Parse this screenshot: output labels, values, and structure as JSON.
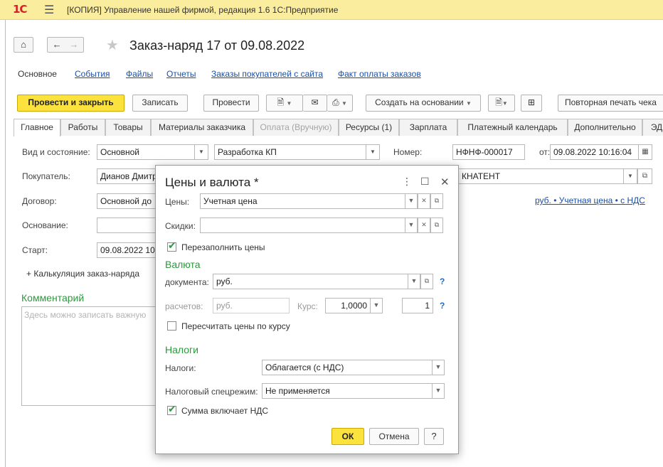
{
  "app": {
    "logo": "1С",
    "title": "[КОПИЯ] Управление нашей фирмой, редакция 1.6 1С:Предприятие"
  },
  "document": {
    "title": "Заказ-наряд 17 от 09.08.2022"
  },
  "subnav": [
    "Основное",
    "События",
    "Файлы",
    "Отчеты",
    "Заказы покупателей с сайта",
    "Факт оплаты заказов"
  ],
  "toolbar": {
    "post_close": "Провести и закрыть",
    "save": "Записать",
    "post": "Провести",
    "create_based": "Создать на основании",
    "reprint": "Повторная печать чека"
  },
  "tabs": [
    "Главное",
    "Работы",
    "Товары",
    "Материалы заказчика",
    "Оплата (Вручную)",
    "Ресурсы (1)",
    "Зарплата",
    "Платежный календарь",
    "Дополнительно",
    "ЭД"
  ],
  "form": {
    "kind_label": "Вид и состояние:",
    "kind_value": "Основной",
    "state_value": "Разработка КП",
    "number_label": "Номер:",
    "number_value": "НФНФ-000017",
    "from_label": "от:",
    "date_value": "09.08.2022 10:16:04",
    "buyer_label": "Покупатель:",
    "buyer_value": "Дианов Дмитр",
    "buyer_right": "КНАТЕНТ",
    "contract_label": "Договор:",
    "contract_value": "Основной до",
    "price_link": "руб. • Учетная цена • с НДС",
    "basis_label": "Основание:",
    "basis_value": "",
    "start_label": "Старт:",
    "start_value": "09.08.2022 10",
    "calc_link": "+ Калькуляция заказ-наряда",
    "comment_title": "Комментарий",
    "comment_placeholder": "Здесь можно записать важную"
  },
  "dialog": {
    "title": "Цены и валюта *",
    "prices_label": "Цены:",
    "prices_value": "Учетная цена",
    "discounts_label": "Скидки:",
    "discounts_value": "",
    "refill_label": "Перезаполнить цены",
    "currency_header": "Валюта",
    "doc_currency_label": "документа:",
    "doc_currency_value": "руб.",
    "settle_label": "расчетов:",
    "settle_value": "руб.",
    "rate_label": "Курс:",
    "rate_value": "1,0000",
    "multiplicity_value": "1",
    "recalc_label": "Пересчитать цены по курсу",
    "taxes_header": "Налоги",
    "taxes_label": "Налоги:",
    "taxes_value": "Облагается (с НДС)",
    "tax_regime_label": "Налоговый спецрежим:",
    "tax_regime_value": "Не применяется",
    "vat_included_label": "Сумма включает НДС",
    "ok": "ОК",
    "cancel": "Отмена",
    "help": "?"
  },
  "states": {
    "refill_checked": true,
    "recalc_checked": false,
    "vat_included_checked": true
  },
  "colors": {
    "titlebar": "#fbed9e",
    "primary_button": "#fce23c",
    "section_green": "#2a9a3b",
    "link_blue": "#1c4fa5"
  }
}
